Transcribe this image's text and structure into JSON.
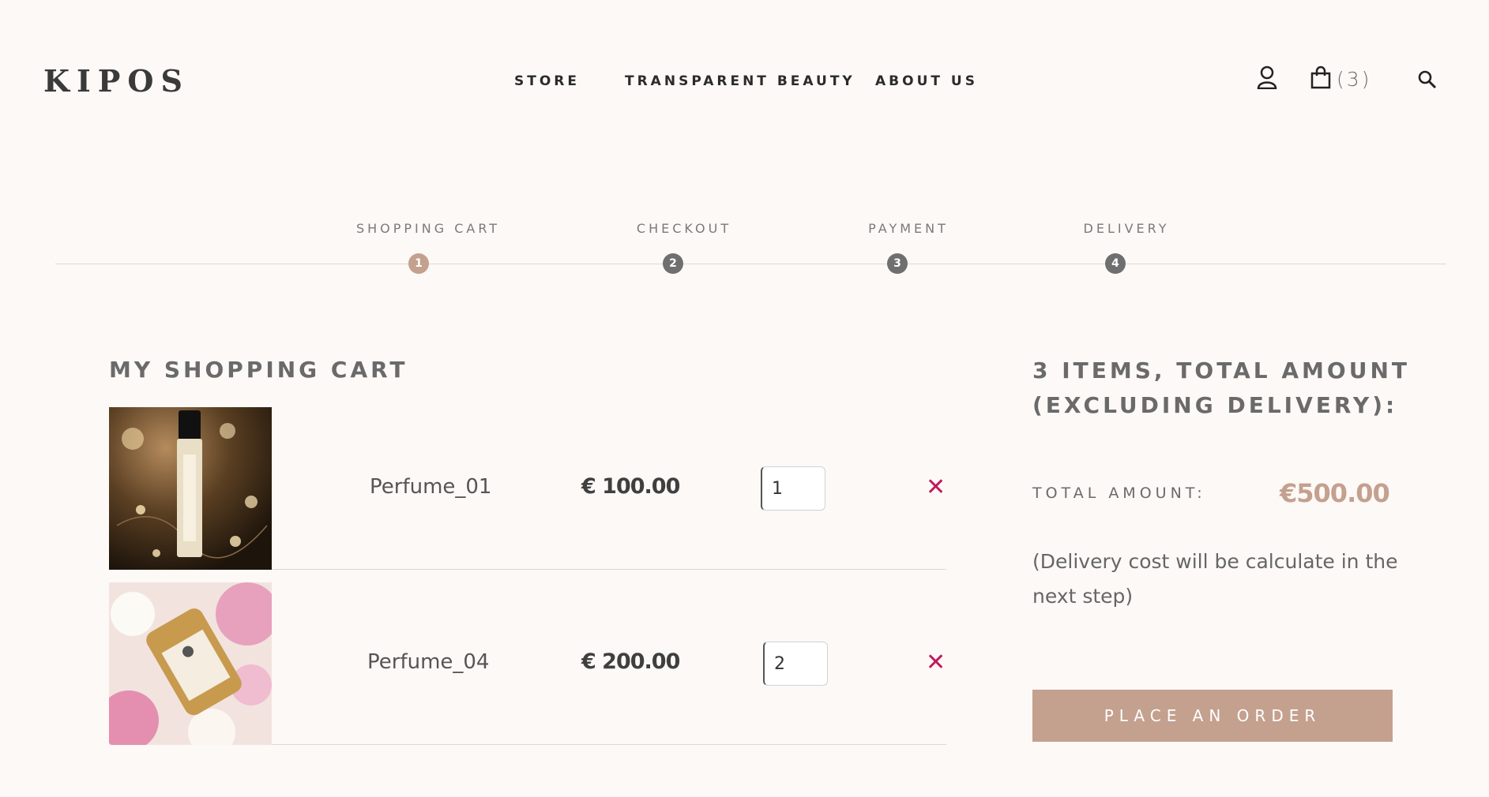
{
  "header": {
    "logo": "KIPOS",
    "nav": [
      "STORE",
      "TRANSPARENT BEAUTY",
      "ABOUT US"
    ],
    "cart_count": "(3)",
    "icons": [
      "user-icon",
      "bag-icon",
      "search-icon"
    ]
  },
  "steps": [
    {
      "label": "SHOPPING CART",
      "number": "1",
      "active": true
    },
    {
      "label": "CHECKOUT",
      "number": "2",
      "active": false
    },
    {
      "label": "PAYMENT",
      "number": "3",
      "active": false
    },
    {
      "label": "DELIVERY",
      "number": "4",
      "active": false
    }
  ],
  "cart": {
    "title": "MY SHOPPING CART",
    "items": [
      {
        "name": "Perfume_01",
        "price": "€ 100.00",
        "qty": "1"
      },
      {
        "name": "Perfume_04",
        "price": "€ 200.00",
        "qty": "2"
      }
    ],
    "remove_glyph": "✕"
  },
  "summary": {
    "title": "3 ITEMS, TOTAL AMOUNT (EXCLUDING DELIVERY):",
    "total_label": "TOTAL AMOUNT:",
    "total_value": "€500.00",
    "note": "(Delivery cost will be calculate in the next step)",
    "order_button": "PLACE AN ORDER"
  },
  "colors": {
    "background": "#fcf9f6",
    "accent": "#c4a08e",
    "remove": "#c2185b",
    "step_inactive": "#6f6f6f"
  }
}
